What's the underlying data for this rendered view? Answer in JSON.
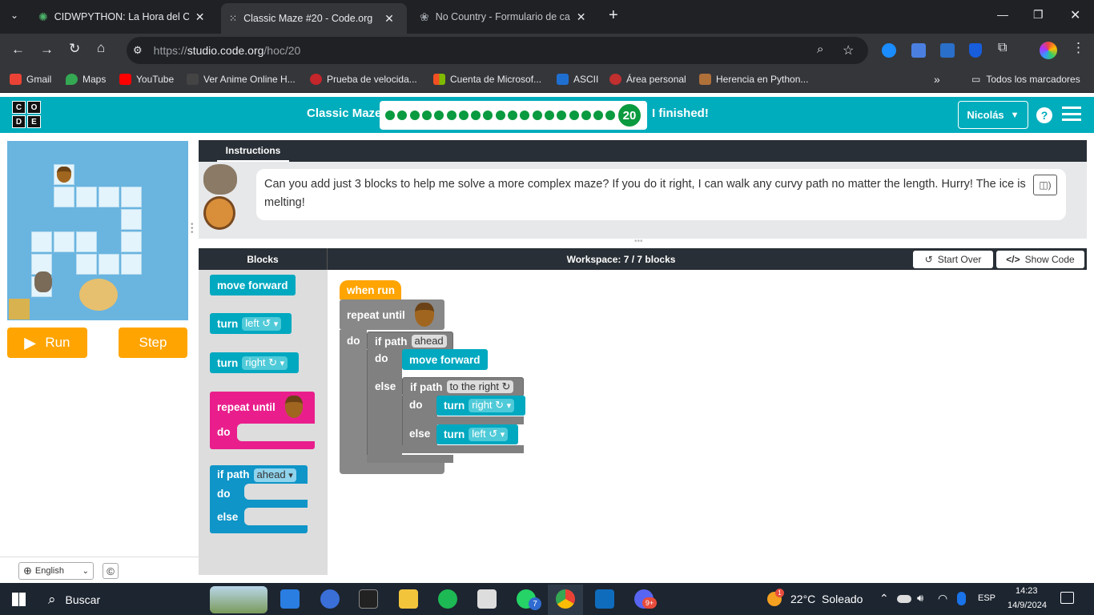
{
  "browser": {
    "tabs": [
      {
        "title": "CIDWPYTHON: La Hora del Cód",
        "icon": "globe-icon"
      },
      {
        "title": "Classic Maze #20 - Code.org",
        "icon": "code-icon"
      },
      {
        "title": "No Country - Formulario de cal",
        "icon": "flower-icon"
      }
    ],
    "url_prefix": "https://",
    "url_domain": "studio.code.org",
    "url_path": "/hoc/20",
    "bookmarks": [
      "Gmail",
      "Maps",
      "YouTube",
      "Ver Anime Online H...",
      "Prueba de velocida...",
      "Cuenta de Microsof...",
      "ASCII",
      "Área personal",
      "Herencia en Python..."
    ],
    "all_bookmarks": "Todos los marcadores"
  },
  "header": {
    "logo_letters": [
      "C",
      "O",
      "D",
      "E"
    ],
    "title": "Classic Maze",
    "level": "20",
    "finished": "I finished!",
    "user": "Nicolás",
    "help": "?"
  },
  "maze": {
    "run": "Run",
    "step": "Step"
  },
  "instructions": {
    "tab": "Instructions",
    "text": "Can you add just 3 blocks to help me solve a more complex maze? If you do it right, I can walk any curvy path no matter the length. Hurry! The ice is melting!"
  },
  "workspace": {
    "blocks_label": "Blocks",
    "title": "Workspace: 7 / 7 blocks",
    "start_over": "Start Over",
    "show_code": "Show Code"
  },
  "toolbox": {
    "move_forward": "move forward",
    "turn": "turn",
    "left": "left ↺",
    "right": "right ↻",
    "repeat_until": "repeat until",
    "do": "do",
    "if_path": "if path",
    "ahead": "ahead",
    "else": "else"
  },
  "program": {
    "when_run": "when run",
    "repeat_until": "repeat until",
    "do": "do",
    "if_path": "if path",
    "ahead": "ahead",
    "move_forward": "move forward",
    "else": "else",
    "to_the_right": "to the right ↻",
    "turn": "turn",
    "right": "right ↻",
    "left": "left ↺"
  },
  "footer": {
    "language": "English",
    "copyright": "©"
  },
  "taskbar": {
    "search": "Buscar",
    "weather": "22°C  Soleado",
    "lang": "ESP",
    "time": "14:23",
    "date": "14/9/2024",
    "whatsapp_badge": "7",
    "discord_badge": "9+",
    "weather_badge": "1"
  }
}
